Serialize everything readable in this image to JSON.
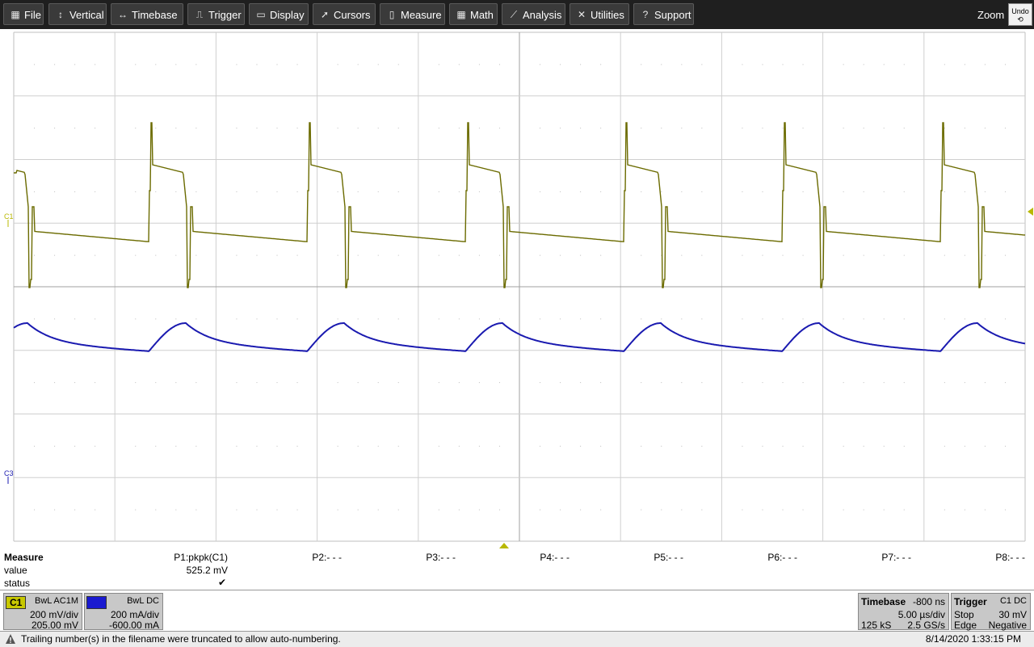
{
  "menu": {
    "items": [
      {
        "label": "File",
        "icon": "file-icon"
      },
      {
        "label": "Vertical",
        "icon": "vertical-arrows-icon"
      },
      {
        "label": "Timebase",
        "icon": "horizontal-arrows-icon"
      },
      {
        "label": "Trigger",
        "icon": "trigger-icon"
      },
      {
        "label": "Display",
        "icon": "display-icon"
      },
      {
        "label": "Cursors",
        "icon": "cursors-icon"
      },
      {
        "label": "Measure",
        "icon": "measure-icon"
      },
      {
        "label": "Math",
        "icon": "math-icon"
      },
      {
        "label": "Analysis",
        "icon": "analysis-icon"
      },
      {
        "label": "Utilities",
        "icon": "utilities-icon"
      },
      {
        "label": "Support",
        "icon": "support-icon"
      }
    ],
    "zoom_label": "Zoom",
    "undo_label": "Undo"
  },
  "waveform": {
    "c1_label": "C1",
    "c3_label": "C3",
    "c1_color": "#6b6b00",
    "c3_color": "#1a1ab0"
  },
  "measure": {
    "title": "Measure",
    "row_value": "value",
    "row_status": "status",
    "params": [
      {
        "name": "P1:pkpk(C1)",
        "value": "525.2 mV",
        "status": "✔"
      },
      {
        "name": "P2:- - -"
      },
      {
        "name": "P3:- - -"
      },
      {
        "name": "P4:- - -"
      },
      {
        "name": "P5:- - -"
      },
      {
        "name": "P6:- - -"
      },
      {
        "name": "P7:- - -"
      },
      {
        "name": "P8:- - -"
      }
    ]
  },
  "channels": {
    "c1": {
      "tag": "C1",
      "coupling": "BwL AC1M",
      "scale": "200 mV/div",
      "offset": "205.00 mV",
      "color": "#c8c800"
    },
    "c3": {
      "tag": "C3",
      "coupling": "BwL DC",
      "scale": "200 mA/div",
      "offset": "-600.00 mA",
      "color": "#1a1ad0"
    }
  },
  "timebase": {
    "title": "Timebase",
    "delay": "-800 ns",
    "scale": "5.00 µs/div",
    "points": "125 kS",
    "rate": "2.5 GS/s"
  },
  "trigger": {
    "title": "Trigger",
    "source": "C1 DC",
    "mode": "Stop",
    "level": "30 mV",
    "type": "Edge",
    "slope": "Negative"
  },
  "status": {
    "message": "Trailing number(s) in the filename were truncated to allow auto-numbering.",
    "datetime": "8/14/2020 1:33:15 PM"
  }
}
